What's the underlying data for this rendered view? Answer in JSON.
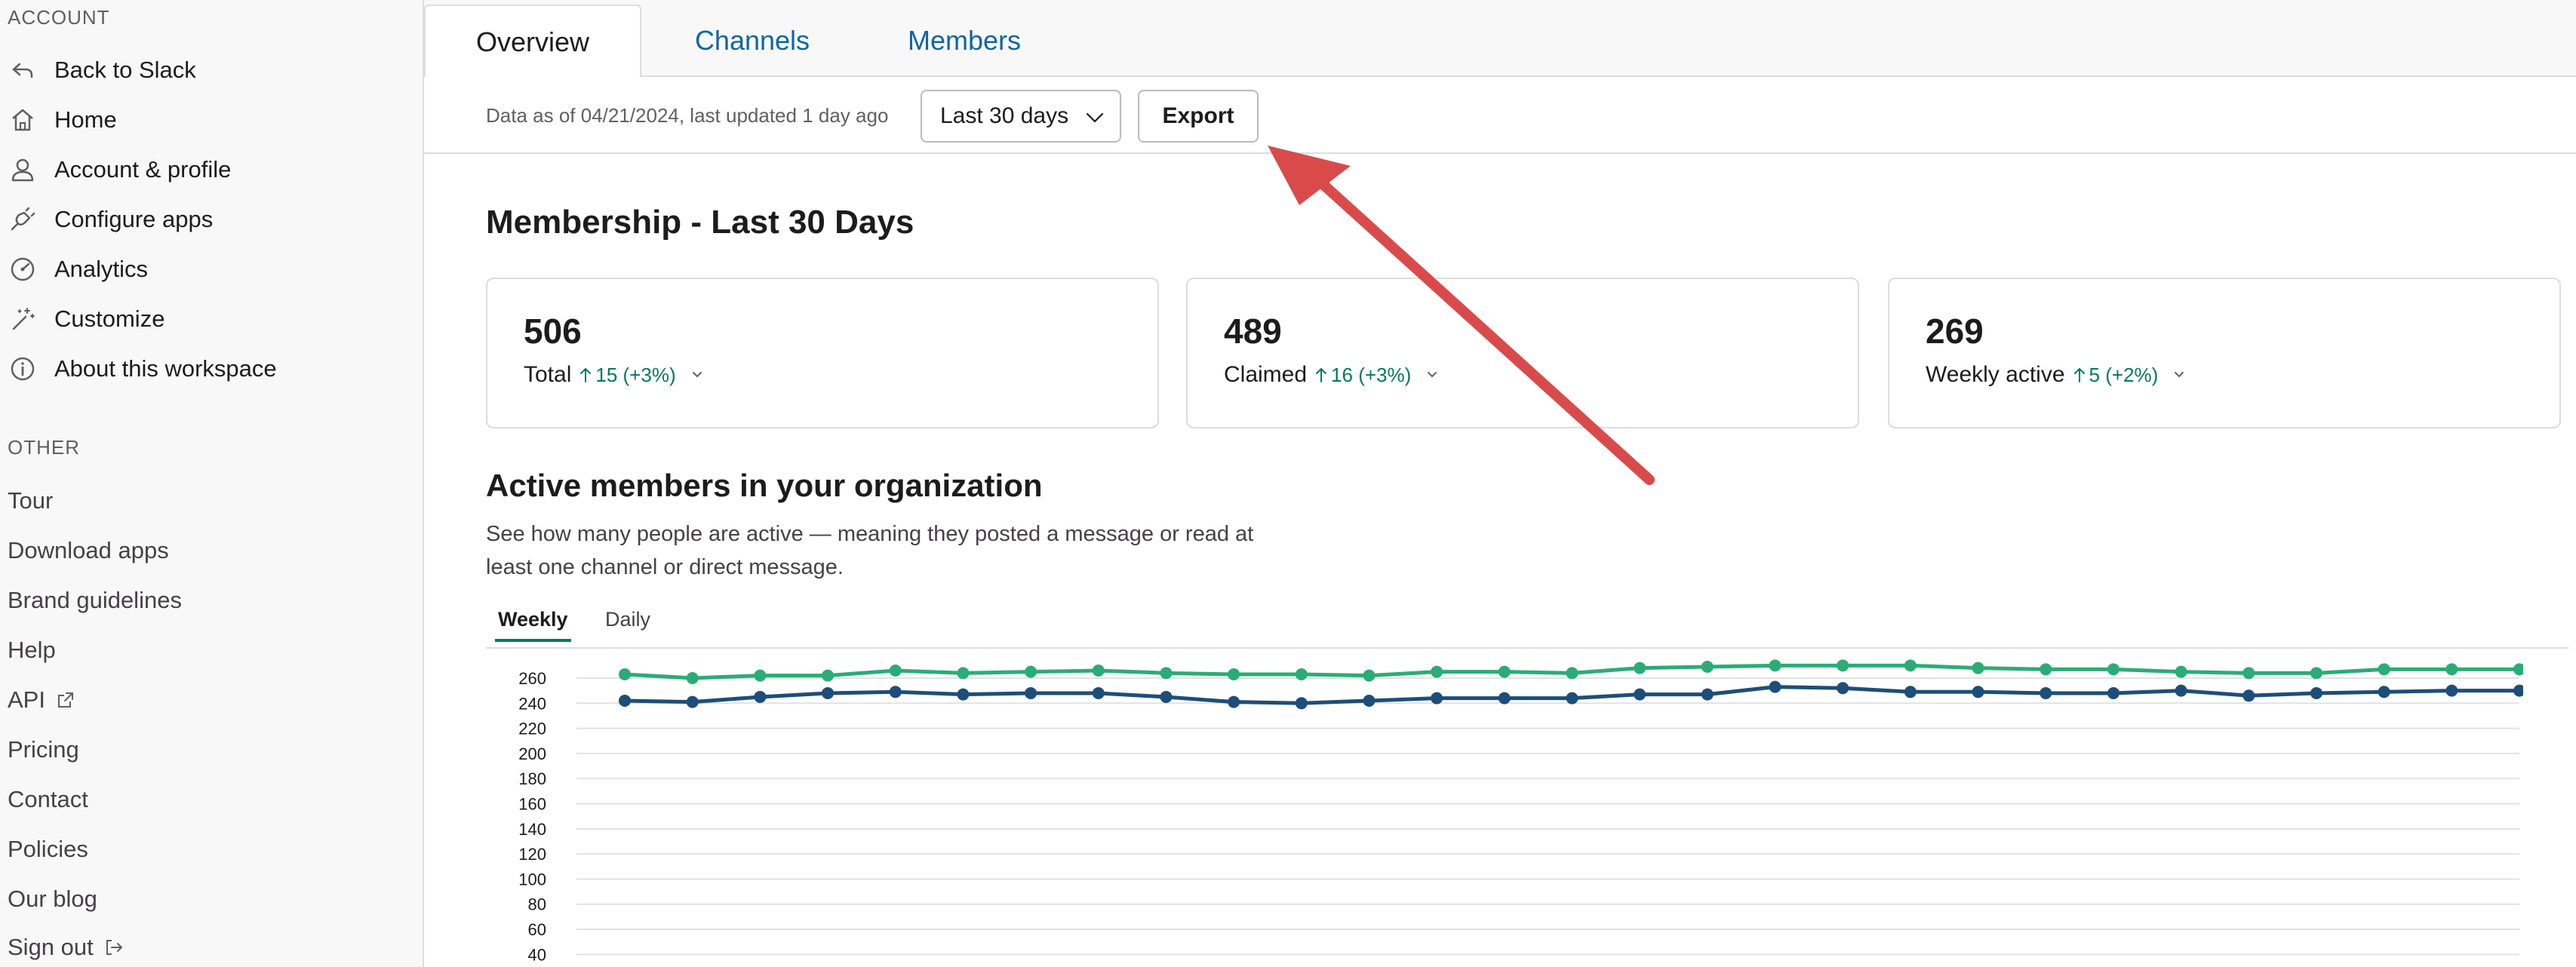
{
  "sidebar": {
    "account_heading": "ACCOUNT",
    "account_items": [
      {
        "label": "Back to Slack",
        "icon": "back-arrow-icon"
      },
      {
        "label": "Home",
        "icon": "home-icon"
      },
      {
        "label": "Account & profile",
        "icon": "user-icon"
      },
      {
        "label": "Configure apps",
        "icon": "plug-icon"
      },
      {
        "label": "Analytics",
        "icon": "gauge-icon"
      },
      {
        "label": "Customize",
        "icon": "wand-icon"
      },
      {
        "label": "About this workspace",
        "icon": "info-icon"
      }
    ],
    "other_heading": "OTHER",
    "other_links": [
      {
        "label": "Tour"
      },
      {
        "label": "Download apps"
      },
      {
        "label": "Brand guidelines"
      },
      {
        "label": "Help"
      },
      {
        "label": "API",
        "external": true
      },
      {
        "label": "Pricing"
      },
      {
        "label": "Contact"
      },
      {
        "label": "Policies"
      },
      {
        "label": "Our blog"
      },
      {
        "label": "Sign out",
        "external": true
      }
    ]
  },
  "tabs": [
    {
      "label": "Overview",
      "active": true
    },
    {
      "label": "Channels",
      "active": false
    },
    {
      "label": "Members",
      "active": false
    }
  ],
  "filter": {
    "data_asof": "Data as of 04/21/2024, last updated 1 day ago",
    "range_value": "Last 30 days",
    "export_label": "Export"
  },
  "membership": {
    "title": "Membership - Last 30 Days",
    "cards": [
      {
        "value": "506",
        "label": "Total",
        "change": "15 (+3%)"
      },
      {
        "value": "489",
        "label": "Claimed",
        "change": "16 (+3%)"
      },
      {
        "value": "269",
        "label": "Weekly active",
        "change": "5 (+2%)"
      }
    ]
  },
  "active_members": {
    "title": "Active members in your organization",
    "description": "See how many people are active — meaning they posted a message or read at least one channel or direct message.",
    "subtabs": [
      {
        "label": "Weekly",
        "active": true
      },
      {
        "label": "Daily",
        "active": false
      }
    ]
  },
  "colors": {
    "green_series": "#2bac76",
    "blue_series": "#1d4e79",
    "accent_green": "#007a5a",
    "link_blue": "#1264a3",
    "annotation_arrow": "#d94b4b"
  },
  "chart_data": {
    "type": "line",
    "y_ticks": [
      40,
      60,
      80,
      100,
      120,
      140,
      160,
      180,
      200,
      220,
      240,
      260
    ],
    "ylim": [
      30,
      275
    ],
    "grid": true,
    "series": [
      {
        "values": [
          263,
          260,
          262,
          262,
          266,
          264,
          265,
          266,
          264,
          263,
          263,
          262,
          265,
          265,
          264,
          268,
          269,
          270,
          270,
          270,
          268,
          267,
          267,
          265,
          264,
          264,
          267,
          267,
          267
        ]
      },
      {
        "values": [
          242,
          241,
          245,
          248,
          249,
          247,
          248,
          248,
          245,
          241,
          240,
          242,
          244,
          244,
          244,
          247,
          247,
          253,
          252,
          249,
          249,
          248,
          248,
          250,
          246,
          248,
          249,
          250,
          250
        ]
      }
    ]
  }
}
